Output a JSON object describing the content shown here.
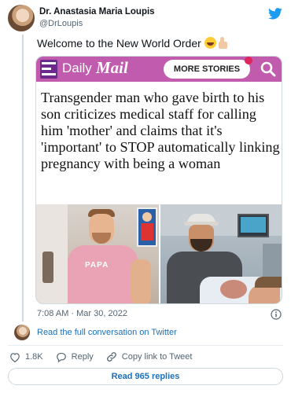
{
  "author": {
    "name": "Dr. Anastasia Maria Loupis",
    "handle": "@DrLoupis"
  },
  "tweet": {
    "text": "Welcome to the New World Order",
    "emojis": [
      "face-with-tears-of-joy",
      "thumbs-up"
    ],
    "timestamp": "7:08 AM · Mar 30, 2022"
  },
  "media": {
    "brand_daily": "Daily",
    "brand_mail": "Mail",
    "more_stories": "MORE STORIES",
    "headline": "Transgender man who gave birth to his son criticizes medical staff for calling him 'mother' and claims that it's 'important' to STOP automatically linking pregnancy with being a woman",
    "shirt_text": "PAPA"
  },
  "links": {
    "read_conversation": "Read the full conversation on Twitter",
    "read_replies": "Read 965 replies"
  },
  "actions": {
    "likes": "1.8K",
    "reply": "Reply",
    "copy_link": "Copy link to Tweet"
  },
  "colors": {
    "twitter_blue": "#1d9bf0",
    "link_blue": "#1d6fb8",
    "dailymail_bar": "#c05bad",
    "text_secondary": "#536471"
  },
  "icons": {
    "logo": "twitter-bird-icon",
    "info": "info-icon",
    "like": "heart-icon",
    "reply": "reply-icon",
    "copy": "link-icon",
    "search": "search-icon"
  }
}
